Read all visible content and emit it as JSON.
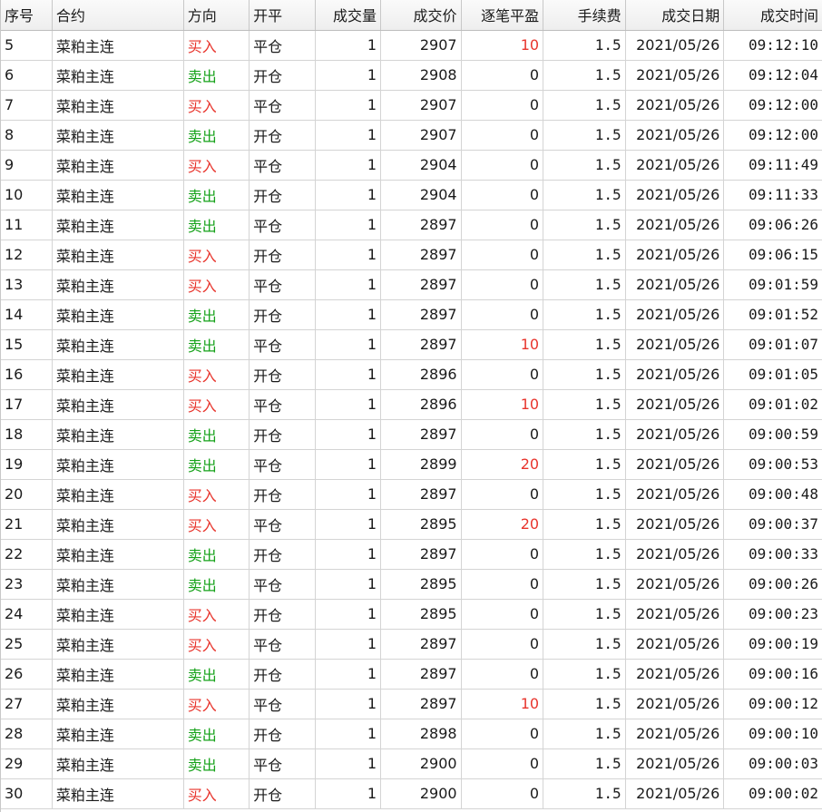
{
  "colors": {
    "buy": "#e8352d",
    "sell": "#16a21a",
    "profit": "#e8352d"
  },
  "headers": {
    "seq": "序号",
    "contract": "合约",
    "direction": "方向",
    "open_close": "开平",
    "volume": "成交量",
    "price": "成交价",
    "pnl": "逐笔平盈",
    "fee": "手续费",
    "date": "成交日期",
    "time": "成交时间"
  },
  "rows": [
    {
      "seq": "5",
      "contract": "菜粕主连",
      "direction": "买入",
      "open_close": "平仓",
      "volume": "1",
      "price": "2907",
      "pnl": "10",
      "fee": "1.5",
      "date": "2021/05/26",
      "time": "09:12:10"
    },
    {
      "seq": "6",
      "contract": "菜粕主连",
      "direction": "卖出",
      "open_close": "开仓",
      "volume": "1",
      "price": "2908",
      "pnl": "0",
      "fee": "1.5",
      "date": "2021/05/26",
      "time": "09:12:04"
    },
    {
      "seq": "7",
      "contract": "菜粕主连",
      "direction": "买入",
      "open_close": "平仓",
      "volume": "1",
      "price": "2907",
      "pnl": "0",
      "fee": "1.5",
      "date": "2021/05/26",
      "time": "09:12:00"
    },
    {
      "seq": "8",
      "contract": "菜粕主连",
      "direction": "卖出",
      "open_close": "开仓",
      "volume": "1",
      "price": "2907",
      "pnl": "0",
      "fee": "1.5",
      "date": "2021/05/26",
      "time": "09:12:00"
    },
    {
      "seq": "9",
      "contract": "菜粕主连",
      "direction": "买入",
      "open_close": "平仓",
      "volume": "1",
      "price": "2904",
      "pnl": "0",
      "fee": "1.5",
      "date": "2021/05/26",
      "time": "09:11:49"
    },
    {
      "seq": "10",
      "contract": "菜粕主连",
      "direction": "卖出",
      "open_close": "开仓",
      "volume": "1",
      "price": "2904",
      "pnl": "0",
      "fee": "1.5",
      "date": "2021/05/26",
      "time": "09:11:33"
    },
    {
      "seq": "11",
      "contract": "菜粕主连",
      "direction": "卖出",
      "open_close": "平仓",
      "volume": "1",
      "price": "2897",
      "pnl": "0",
      "fee": "1.5",
      "date": "2021/05/26",
      "time": "09:06:26"
    },
    {
      "seq": "12",
      "contract": "菜粕主连",
      "direction": "买入",
      "open_close": "开仓",
      "volume": "1",
      "price": "2897",
      "pnl": "0",
      "fee": "1.5",
      "date": "2021/05/26",
      "time": "09:06:15"
    },
    {
      "seq": "13",
      "contract": "菜粕主连",
      "direction": "买入",
      "open_close": "平仓",
      "volume": "1",
      "price": "2897",
      "pnl": "0",
      "fee": "1.5",
      "date": "2021/05/26",
      "time": "09:01:59"
    },
    {
      "seq": "14",
      "contract": "菜粕主连",
      "direction": "卖出",
      "open_close": "开仓",
      "volume": "1",
      "price": "2897",
      "pnl": "0",
      "fee": "1.5",
      "date": "2021/05/26",
      "time": "09:01:52"
    },
    {
      "seq": "15",
      "contract": "菜粕主连",
      "direction": "卖出",
      "open_close": "平仓",
      "volume": "1",
      "price": "2897",
      "pnl": "10",
      "fee": "1.5",
      "date": "2021/05/26",
      "time": "09:01:07"
    },
    {
      "seq": "16",
      "contract": "菜粕主连",
      "direction": "买入",
      "open_close": "开仓",
      "volume": "1",
      "price": "2896",
      "pnl": "0",
      "fee": "1.5",
      "date": "2021/05/26",
      "time": "09:01:05"
    },
    {
      "seq": "17",
      "contract": "菜粕主连",
      "direction": "买入",
      "open_close": "平仓",
      "volume": "1",
      "price": "2896",
      "pnl": "10",
      "fee": "1.5",
      "date": "2021/05/26",
      "time": "09:01:02"
    },
    {
      "seq": "18",
      "contract": "菜粕主连",
      "direction": "卖出",
      "open_close": "开仓",
      "volume": "1",
      "price": "2897",
      "pnl": "0",
      "fee": "1.5",
      "date": "2021/05/26",
      "time": "09:00:59"
    },
    {
      "seq": "19",
      "contract": "菜粕主连",
      "direction": "卖出",
      "open_close": "平仓",
      "volume": "1",
      "price": "2899",
      "pnl": "20",
      "fee": "1.5",
      "date": "2021/05/26",
      "time": "09:00:53"
    },
    {
      "seq": "20",
      "contract": "菜粕主连",
      "direction": "买入",
      "open_close": "开仓",
      "volume": "1",
      "price": "2897",
      "pnl": "0",
      "fee": "1.5",
      "date": "2021/05/26",
      "time": "09:00:48"
    },
    {
      "seq": "21",
      "contract": "菜粕主连",
      "direction": "买入",
      "open_close": "平仓",
      "volume": "1",
      "price": "2895",
      "pnl": "20",
      "fee": "1.5",
      "date": "2021/05/26",
      "time": "09:00:37"
    },
    {
      "seq": "22",
      "contract": "菜粕主连",
      "direction": "卖出",
      "open_close": "开仓",
      "volume": "1",
      "price": "2897",
      "pnl": "0",
      "fee": "1.5",
      "date": "2021/05/26",
      "time": "09:00:33"
    },
    {
      "seq": "23",
      "contract": "菜粕主连",
      "direction": "卖出",
      "open_close": "平仓",
      "volume": "1",
      "price": "2895",
      "pnl": "0",
      "fee": "1.5",
      "date": "2021/05/26",
      "time": "09:00:26"
    },
    {
      "seq": "24",
      "contract": "菜粕主连",
      "direction": "买入",
      "open_close": "开仓",
      "volume": "1",
      "price": "2895",
      "pnl": "0",
      "fee": "1.5",
      "date": "2021/05/26",
      "time": "09:00:23"
    },
    {
      "seq": "25",
      "contract": "菜粕主连",
      "direction": "买入",
      "open_close": "平仓",
      "volume": "1",
      "price": "2897",
      "pnl": "0",
      "fee": "1.5",
      "date": "2021/05/26",
      "time": "09:00:19"
    },
    {
      "seq": "26",
      "contract": "菜粕主连",
      "direction": "卖出",
      "open_close": "开仓",
      "volume": "1",
      "price": "2897",
      "pnl": "0",
      "fee": "1.5",
      "date": "2021/05/26",
      "time": "09:00:16"
    },
    {
      "seq": "27",
      "contract": "菜粕主连",
      "direction": "买入",
      "open_close": "平仓",
      "volume": "1",
      "price": "2897",
      "pnl": "10",
      "fee": "1.5",
      "date": "2021/05/26",
      "time": "09:00:12"
    },
    {
      "seq": "28",
      "contract": "菜粕主连",
      "direction": "卖出",
      "open_close": "开仓",
      "volume": "1",
      "price": "2898",
      "pnl": "0",
      "fee": "1.5",
      "date": "2021/05/26",
      "time": "09:00:10"
    },
    {
      "seq": "29",
      "contract": "菜粕主连",
      "direction": "卖出",
      "open_close": "平仓",
      "volume": "1",
      "price": "2900",
      "pnl": "0",
      "fee": "1.5",
      "date": "2021/05/26",
      "time": "09:00:03"
    },
    {
      "seq": "30",
      "contract": "菜粕主连",
      "direction": "买入",
      "open_close": "开仓",
      "volume": "1",
      "price": "2900",
      "pnl": "0",
      "fee": "1.5",
      "date": "2021/05/26",
      "time": "09:00:02"
    }
  ]
}
